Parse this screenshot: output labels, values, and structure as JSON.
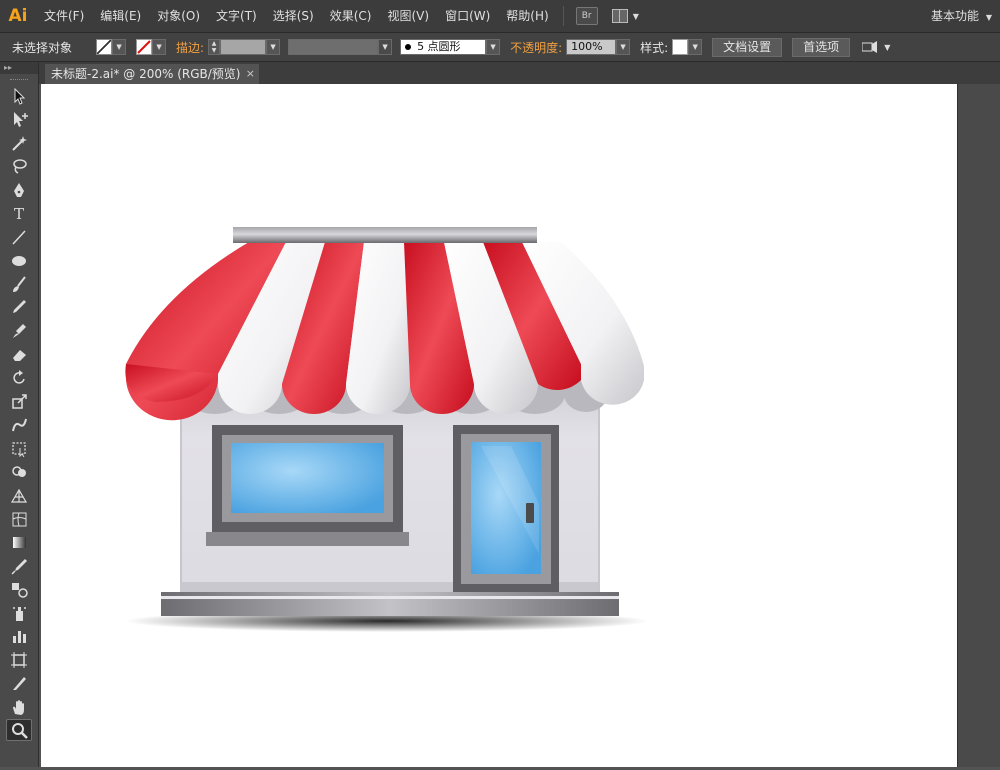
{
  "app": {
    "logo": "Ai",
    "workspace": "基本功能"
  },
  "menu": [
    {
      "id": "file",
      "label": "文件(F)"
    },
    {
      "id": "edit",
      "label": "编辑(E)"
    },
    {
      "id": "object",
      "label": "对象(O)"
    },
    {
      "id": "type",
      "label": "文字(T)"
    },
    {
      "id": "select",
      "label": "选择(S)"
    },
    {
      "id": "effect",
      "label": "效果(C)"
    },
    {
      "id": "view",
      "label": "视图(V)"
    },
    {
      "id": "window",
      "label": "窗口(W)"
    },
    {
      "id": "help",
      "label": "帮助(H)"
    }
  ],
  "bridge_label": "Br",
  "control": {
    "selection_status": "未选择对象",
    "stroke_label": "描边:",
    "brush_value": "5 点圆形",
    "opacity_label": "不透明度:",
    "opacity_value": "100%",
    "style_label": "样式:",
    "doc_setup_button": "文档设置",
    "preferences_button": "首选项"
  },
  "document": {
    "tab_title": "未标题-2.ai* @ 200% (RGB/预览)",
    "close_glyph": "×"
  },
  "tools": [
    {
      "name": "selection-tool-icon"
    },
    {
      "name": "direct-selection-tool-icon"
    },
    {
      "name": "magic-wand-tool-icon"
    },
    {
      "name": "lasso-tool-icon"
    },
    {
      "name": "pen-tool-icon"
    },
    {
      "name": "type-tool-icon",
      "glyph": "T"
    },
    {
      "name": "line-tool-icon"
    },
    {
      "name": "ellipse-tool-icon"
    },
    {
      "name": "paintbrush-tool-icon"
    },
    {
      "name": "pencil-tool-icon"
    },
    {
      "name": "blob-brush-tool-icon"
    },
    {
      "name": "eraser-tool-icon"
    },
    {
      "name": "rotate-tool-icon"
    },
    {
      "name": "scale-tool-icon"
    },
    {
      "name": "warp-tool-icon"
    },
    {
      "name": "free-transform-tool-icon"
    },
    {
      "name": "shape-builder-tool-icon"
    },
    {
      "name": "perspective-grid-tool-icon"
    },
    {
      "name": "mesh-tool-icon"
    },
    {
      "name": "gradient-tool-icon"
    },
    {
      "name": "eyedropper-tool-icon"
    },
    {
      "name": "blend-tool-icon"
    },
    {
      "name": "symbol-sprayer-tool-icon"
    },
    {
      "name": "column-graph-tool-icon"
    },
    {
      "name": "artboard-tool-icon"
    },
    {
      "name": "slice-tool-icon"
    },
    {
      "name": "hand-tool-icon"
    },
    {
      "name": "zoom-tool-icon",
      "active": true
    }
  ],
  "colors": {
    "awning_red": "#d8192a",
    "awning_white": "#f4f4f6",
    "wall": "#e1e0e6",
    "frame": "#5e5e62",
    "glass": "#5ab0ea"
  }
}
